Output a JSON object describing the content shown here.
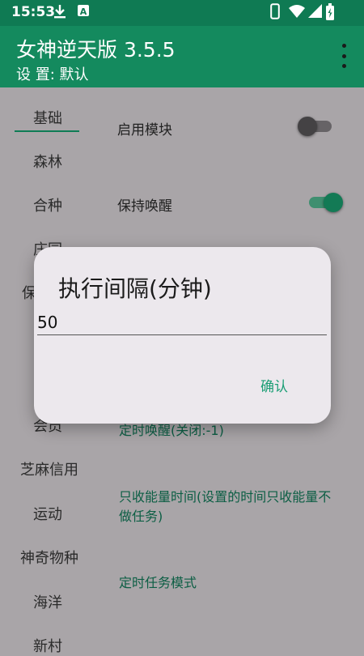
{
  "statusbar": {
    "time": "15:53",
    "left_icons": [
      "download-icon",
      "a-badge-icon"
    ],
    "right_icons": [
      "phone-icon",
      "wifi-icon",
      "signal-icon",
      "battery-icon"
    ]
  },
  "appbar": {
    "title": "女神逆天版 3.5.5",
    "subtitle": "设 置: 默认",
    "more_icon": "more-vert-icon"
  },
  "nav": {
    "items": [
      "基础",
      "森林",
      "合种",
      "庄园",
      "保",
      "会员",
      "芝麻信用",
      "运动",
      "神奇物种",
      "海洋",
      "新村"
    ],
    "selected": "基础"
  },
  "settings": {
    "enable_module": {
      "label": "启用模块",
      "on": false
    },
    "keep_awake": {
      "label": "保持唤醒",
      "on": true
    },
    "timed_wake": "定时唤醒(关闭:-1)",
    "energy_only_time": "只收能量时间(设置的时间只收能量不做任务)",
    "timed_task_mode": "定时任务模式"
  },
  "dialog": {
    "title": "执行间隔(分钟)",
    "input_value": "50",
    "confirm": "确认"
  },
  "colors": {
    "statusbar": "#0f7a53",
    "appbar": "#148a5e",
    "accent": "#1b9e75",
    "scrim_background": "#a9a5a8"
  }
}
